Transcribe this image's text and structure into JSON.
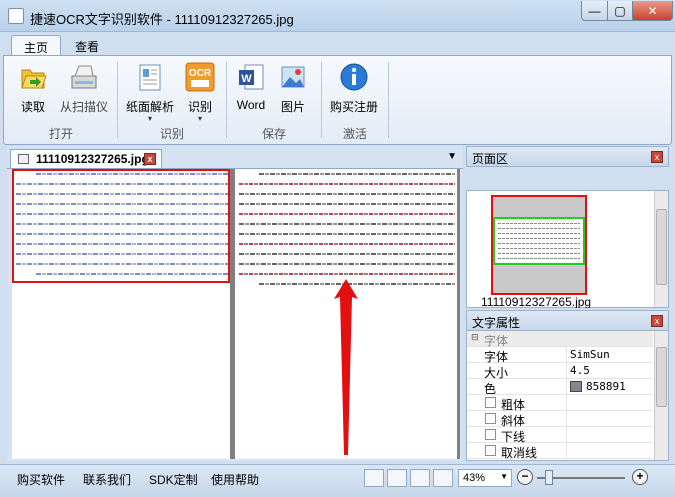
{
  "window": {
    "title": "捷速OCR文字识别软件 - 11110912327265.jpg",
    "min_symbol": "—",
    "max_symbol": "▢",
    "close_symbol": "✕"
  },
  "tabs": [
    {
      "label": "主页",
      "active": true
    },
    {
      "label": "查看",
      "active": false
    }
  ],
  "ribbon": {
    "groups": [
      {
        "label": "打开",
        "buttons": [
          {
            "label": "读取",
            "icon": "folder-open-icon"
          },
          {
            "label": "从扫描仪",
            "icon": "scanner-icon"
          }
        ]
      },
      {
        "label": "识别",
        "buttons": [
          {
            "label": "纸面解析",
            "icon": "page-layout-icon"
          },
          {
            "label": "识别",
            "icon": "ocr-icon"
          }
        ]
      },
      {
        "label": "保存",
        "buttons": [
          {
            "label": "Word",
            "icon": "word-icon"
          },
          {
            "label": "图片",
            "icon": "picture-icon"
          }
        ]
      },
      {
        "label": "激活",
        "buttons": [
          {
            "label": "购买注册",
            "icon": "info-icon"
          }
        ]
      }
    ],
    "ocr_icon_text": "OCR"
  },
  "document": {
    "tab_title": "11110912327265.jpg",
    "tab_close": "x"
  },
  "page_panel": {
    "title": "页面区",
    "thumb_caption": "11110912327265.jpg"
  },
  "text_props": {
    "title": "文字属性",
    "category": "字体",
    "rows": [
      {
        "key": "字体",
        "value": "SimSun"
      },
      {
        "key": "大小",
        "value": "4.5"
      },
      {
        "key": "色",
        "value": "858891",
        "swatch": "#858891"
      }
    ],
    "checkboxes": [
      {
        "label": "粗体",
        "checked": false
      },
      {
        "label": "斜体",
        "checked": false
      },
      {
        "label": "下线",
        "checked": false
      },
      {
        "label": "取消线",
        "checked": false
      }
    ]
  },
  "statusbar": {
    "links": [
      "购买软件",
      "联系我们",
      "SDK定制",
      "使用帮助"
    ],
    "zoom": "43%",
    "zoom_fraction": 0.1
  },
  "colors": {
    "accent": "#e21010",
    "green_box": "#22cc22",
    "viewer_bg": "#808080"
  }
}
